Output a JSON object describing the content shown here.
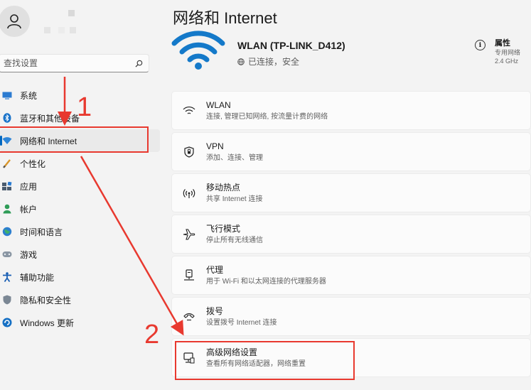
{
  "user": {
    "avatar_icon": "person-icon"
  },
  "search": {
    "placeholder": "查找设置",
    "icon": "search-icon"
  },
  "sidebar": {
    "items": [
      {
        "label": "系统",
        "icon": "system-icon"
      },
      {
        "label": "蓝牙和其他设备",
        "icon": "bluetooth-icon"
      },
      {
        "label": "网络和 Internet",
        "icon": "network-icon",
        "active": true
      },
      {
        "label": "个性化",
        "icon": "brush-icon"
      },
      {
        "label": "应用",
        "icon": "apps-icon"
      },
      {
        "label": "帐户",
        "icon": "account-icon"
      },
      {
        "label": "时间和语言",
        "icon": "globe-icon"
      },
      {
        "label": "游戏",
        "icon": "gamepad-icon"
      },
      {
        "label": "辅助功能",
        "icon": "accessibility-icon"
      },
      {
        "label": "隐私和安全性",
        "icon": "shield-icon"
      },
      {
        "label": "Windows 更新",
        "icon": "update-icon"
      }
    ]
  },
  "main": {
    "title": "网络和 Internet",
    "connection": {
      "ssid": "WLAN (TP-LINK_D412)",
      "status": "已连接，安全",
      "properties": {
        "label": "属性",
        "type": "专用网络",
        "band": "2.4 GHz"
      }
    },
    "cards": [
      {
        "title": "WLAN",
        "subtitle": "连接, 管理已知网络, 按流量计费的网络",
        "icon": "wifi-icon"
      },
      {
        "title": "VPN",
        "subtitle": "添加、连接、管理",
        "icon": "vpn-shield-icon"
      },
      {
        "title": "移动热点",
        "subtitle": "共享 Internet 连接",
        "icon": "hotspot-icon"
      },
      {
        "title": "飞行模式",
        "subtitle": "停止所有无线通信",
        "icon": "airplane-icon"
      },
      {
        "title": "代理",
        "subtitle": "用于 Wi-Fi 和以太网连接的代理服务器",
        "icon": "proxy-icon"
      },
      {
        "title": "拨号",
        "subtitle": "设置拨号 Internet 连接",
        "icon": "dialup-icon"
      },
      {
        "title": "高级网络设置",
        "subtitle": "查看所有网络适配器，网络重置",
        "icon": "advanced-network-icon"
      }
    ]
  },
  "annotations": {
    "step1": "1",
    "step2": "2",
    "color": "#e8392f"
  },
  "colors": {
    "accent": "#0067c0",
    "wifi_blue": "#1479c9",
    "background": "#f3f3f3"
  }
}
